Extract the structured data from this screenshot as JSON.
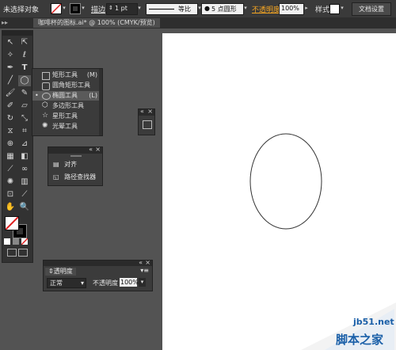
{
  "control_bar": {
    "no_selection": "未选择对象",
    "stroke_label": "描边",
    "stroke_weight": "1 pt",
    "stroke_profile": "等比",
    "brush": "5 点圆形",
    "opacity_label": "不透明度",
    "opacity_value": "100%",
    "style_label": "样式",
    "doc_settings": "文档设置",
    "accent": "#f5a623"
  },
  "document_tab": "咖啡杯的图标.ai* @ 100% (CMYK/预览)",
  "shape_flyout": {
    "items": [
      {
        "label": "矩形工具",
        "shortcut": "(M)"
      },
      {
        "label": "圆角矩形工具",
        "shortcut": ""
      },
      {
        "label": "椭圆工具",
        "shortcut": "(L)",
        "selected": true
      },
      {
        "label": "多边形工具",
        "shortcut": ""
      },
      {
        "label": "星形工具",
        "shortcut": ""
      },
      {
        "label": "光晕工具",
        "shortcut": ""
      }
    ]
  },
  "align_panel": {
    "items": [
      {
        "label": "对齐"
      },
      {
        "label": "路径查找器"
      }
    ]
  },
  "transparency_panel": {
    "title": "透明度",
    "mode": "正常",
    "opacity_label": "不透明度",
    "opacity_value": "100%"
  },
  "watermark": {
    "url": "jb51.net",
    "name": "脚本之家"
  },
  "colors": {
    "ui_dark": "#3a3a3a",
    "workspace": "#535353",
    "artboard": "#ffffff",
    "watermark_blue": "#1a5fa8"
  }
}
